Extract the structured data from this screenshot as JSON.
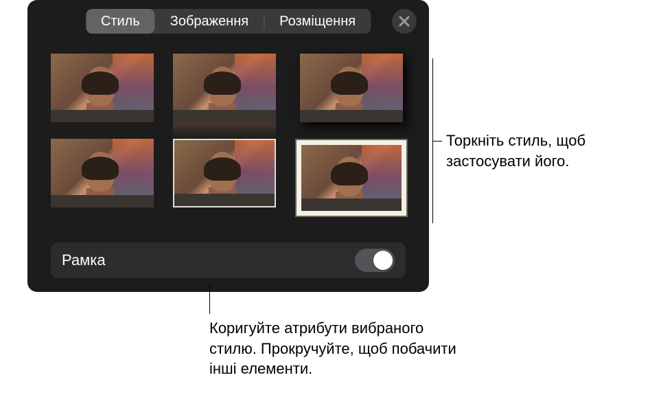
{
  "tabs": {
    "style": "Стиль",
    "image": "Зображення",
    "arrange": "Розміщення",
    "selected_index": 0
  },
  "styles": {
    "count": 6,
    "selected_index": 5
  },
  "frame_row": {
    "label": "Рамка",
    "switch_on": false
  },
  "callouts": {
    "right": "Торкніть стиль, щоб застосувати його.",
    "bottom": "Коригуйте атрибути вибраного стилю. Прокручуйте, щоб побачити інші елементи."
  },
  "icons": {
    "close": "close"
  }
}
